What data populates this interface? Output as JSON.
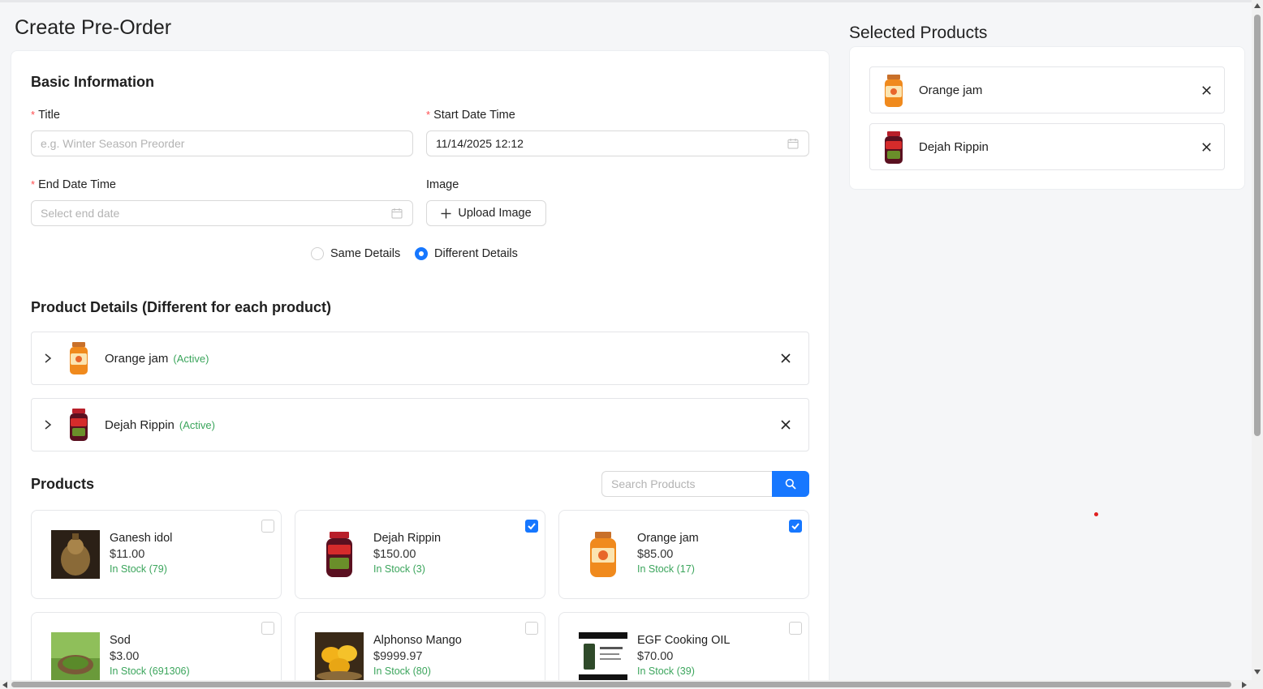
{
  "page": {
    "title": "Create Pre-Order"
  },
  "basic_info": {
    "heading": "Basic Information",
    "title_label": "Title",
    "title_placeholder": "e.g. Winter Season Preorder",
    "start_label": "Start Date Time",
    "start_value": "11/14/2025 12:12",
    "end_label": "End Date Time",
    "end_placeholder": "Select end date",
    "image_label": "Image",
    "upload_label": "Upload Image",
    "radio_options": [
      {
        "label": "Same Details",
        "selected": false
      },
      {
        "label": "Different Details",
        "selected": true
      }
    ]
  },
  "product_details": {
    "heading": "Product Details (Different for each product)",
    "items": [
      {
        "name": "Orange jam",
        "status": "(Active)"
      },
      {
        "name": "Dejah Rippin",
        "status": "(Active)"
      }
    ]
  },
  "products": {
    "heading": "Products",
    "search_placeholder": "Search Products",
    "items": [
      {
        "name": "Ganesh idol",
        "price": "$11.00",
        "stock": "In Stock (79)",
        "checked": false
      },
      {
        "name": "Dejah Rippin",
        "price": "$150.00",
        "stock": "In Stock (3)",
        "checked": true
      },
      {
        "name": "Orange jam",
        "price": "$85.00",
        "stock": "In Stock (17)",
        "checked": true
      },
      {
        "name": "Sod",
        "price": "$3.00",
        "stock": "In Stock (691306)",
        "checked": false
      },
      {
        "name": "Alphonso Mango",
        "price": "$9999.97",
        "stock": "In Stock (80)",
        "checked": false
      },
      {
        "name": "EGF Cooking OIL",
        "price": "$70.00",
        "stock": "In Stock (39)",
        "checked": false
      }
    ]
  },
  "selected_products": {
    "heading": "Selected Products",
    "items": [
      {
        "name": "Orange jam"
      },
      {
        "name": "Dejah Rippin"
      }
    ]
  },
  "colors": {
    "accent": "#1677ff",
    "required": "#ff4d4f",
    "stock": "#3ba55c"
  }
}
